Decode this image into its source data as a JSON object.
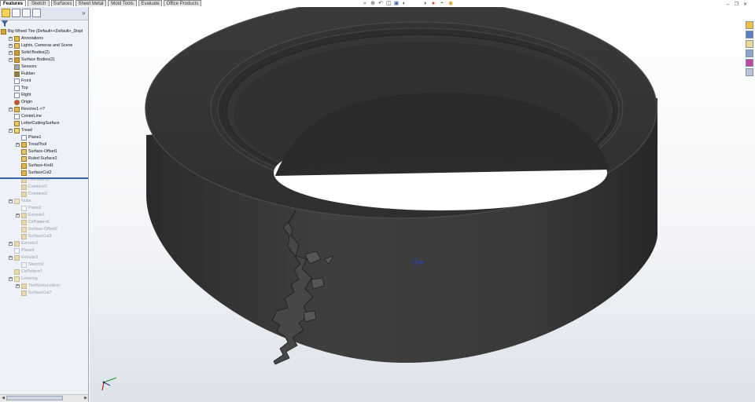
{
  "command_tabs": [
    "Features",
    "Sketch",
    "Surfaces",
    "Sheet Metal",
    "Mold Tools",
    "Evaluate",
    "Office Products"
  ],
  "active_tab": "Features",
  "panel": {
    "expand_label": "»",
    "tree": [
      {
        "label": "Big Wheel Tire  (Default<<Default>_Displ",
        "icon": "part-icon",
        "expander": false,
        "depth": 0,
        "suppressed": false
      },
      {
        "label": "Annotations",
        "icon": "annotations-icon",
        "expander": true,
        "depth": 1,
        "suppressed": false
      },
      {
        "label": "Lights, Cameras and Scene",
        "icon": "lights-icon",
        "expander": true,
        "depth": 1,
        "suppressed": false
      },
      {
        "label": "Solid Bodies(2)",
        "icon": "solid-bodies-icon",
        "expander": true,
        "depth": 1,
        "suppressed": false
      },
      {
        "label": "Surface Bodies(2)",
        "icon": "surface-bodies-icon",
        "expander": true,
        "depth": 1,
        "suppressed": false
      },
      {
        "label": "Sensors",
        "icon": "sensors-icon",
        "expander": false,
        "depth": 1,
        "suppressed": false
      },
      {
        "label": "Rubber",
        "icon": "material-icon",
        "expander": false,
        "depth": 1,
        "suppressed": false
      },
      {
        "label": "Front",
        "icon": "plane-icon",
        "expander": false,
        "depth": 1,
        "suppressed": false
      },
      {
        "label": "Top",
        "icon": "plane-icon",
        "expander": false,
        "depth": 1,
        "suppressed": false
      },
      {
        "label": "Right",
        "icon": "plane-icon",
        "expander": false,
        "depth": 1,
        "suppressed": false
      },
      {
        "label": "Origin",
        "icon": "origin-icon",
        "expander": false,
        "depth": 1,
        "suppressed": false
      },
      {
        "label": "Revolve1->?",
        "icon": "revolve-icon",
        "expander": true,
        "depth": 1,
        "suppressed": false
      },
      {
        "label": "CenterLine",
        "icon": "sketch-icon",
        "expander": false,
        "depth": 1,
        "suppressed": false
      },
      {
        "label": "LetterCuttingSurface",
        "icon": "surface-icon",
        "expander": false,
        "depth": 1,
        "suppressed": false
      },
      {
        "label": "Tread",
        "icon": "folder-icon",
        "expander": true,
        "depth": 1,
        "suppressed": false
      },
      {
        "label": "Plane1",
        "icon": "plane-icon",
        "expander": false,
        "depth": 2,
        "suppressed": false
      },
      {
        "label": "TreadTool",
        "icon": "extrude-icon",
        "expander": true,
        "depth": 2,
        "suppressed": false
      },
      {
        "label": "Surface-Offset1",
        "icon": "surface-icon",
        "expander": false,
        "depth": 2,
        "suppressed": false
      },
      {
        "label": "Ruled Surface2",
        "icon": "surface-icon",
        "expander": false,
        "depth": 2,
        "suppressed": false
      },
      {
        "label": "Surface-Knit1",
        "icon": "knit-icon",
        "expander": false,
        "depth": 2,
        "suppressed": false
      },
      {
        "label": "SurfaceCut2",
        "icon": "surface-cut-icon",
        "expander": false,
        "depth": 2,
        "suppressed": false
      },
      {
        "label": "CirPattern5",
        "icon": "pattern-icon",
        "expander": false,
        "depth": 2,
        "suppressed": true
      },
      {
        "label": "Combine1",
        "icon": "combine-icon",
        "expander": false,
        "depth": 2,
        "suppressed": true
      },
      {
        "label": "Combine2",
        "icon": "combine-icon",
        "expander": false,
        "depth": 2,
        "suppressed": true
      },
      {
        "label": "Nubs",
        "icon": "folder-icon",
        "expander": true,
        "depth": 1,
        "suppressed": true
      },
      {
        "label": "Plane2",
        "icon": "plane-icon",
        "expander": false,
        "depth": 2,
        "suppressed": true
      },
      {
        "label": "Extrude1",
        "icon": "extrude-icon",
        "expander": true,
        "depth": 2,
        "suppressed": true
      },
      {
        "label": "CirPattern6",
        "icon": "pattern-icon",
        "expander": false,
        "depth": 2,
        "suppressed": true
      },
      {
        "label": "Surface-Offset2",
        "icon": "surface-icon",
        "expander": false,
        "depth": 2,
        "suppressed": true
      },
      {
        "label": "SurfaceCut3",
        "icon": "surface-cut-icon",
        "expander": false,
        "depth": 2,
        "suppressed": true
      },
      {
        "label": "Extrude2",
        "icon": "extrude-icon",
        "expander": true,
        "depth": 1,
        "suppressed": true
      },
      {
        "label": "Plane4",
        "icon": "plane-icon",
        "expander": false,
        "depth": 1,
        "suppressed": true
      },
      {
        "label": "Extrude3",
        "icon": "extrude-icon",
        "expander": true,
        "depth": 1,
        "suppressed": true
      },
      {
        "label": "Sketch9",
        "icon": "sketch-icon",
        "expander": false,
        "depth": 2,
        "suppressed": true
      },
      {
        "label": "CirPattern7",
        "icon": "pattern-icon",
        "expander": false,
        "depth": 1,
        "suppressed": true
      },
      {
        "label": "Lettering",
        "icon": "folder-icon",
        "expander": true,
        "depth": 1,
        "suppressed": true
      },
      {
        "label": "TireWorksLetters",
        "icon": "extrude-icon",
        "expander": true,
        "depth": 2,
        "suppressed": true
      },
      {
        "label": "SurfaceCut7",
        "icon": "surface-cut-icon",
        "expander": false,
        "depth": 2,
        "suppressed": true
      }
    ]
  },
  "heads_up_toolbar": [
    "zoom-to-fit-icon",
    "zoom-to-area-icon",
    "previous-view-icon",
    "section-view-icon",
    "view-orientation-icon",
    "display-style-icon",
    "hide-show-icon",
    "edit-appearance-icon",
    "apply-scene-icon",
    "realview-icon"
  ],
  "window_controls": [
    "minimize-icon",
    "restore-icon",
    "close-icon"
  ],
  "task_pane": [
    "resources-icon",
    "design-library-icon",
    "file-explorer-icon",
    "view-palette-icon",
    "appearances-icon",
    "custom-properties-icon"
  ],
  "colors": {
    "tire": "#3b3b3b",
    "tire_dark": "#252525",
    "tire_light": "#4a4a4a",
    "panel_bg": "#eef2f8",
    "rollback_bar": "#3a5ea8",
    "selected_tool": "#f4d25a"
  }
}
